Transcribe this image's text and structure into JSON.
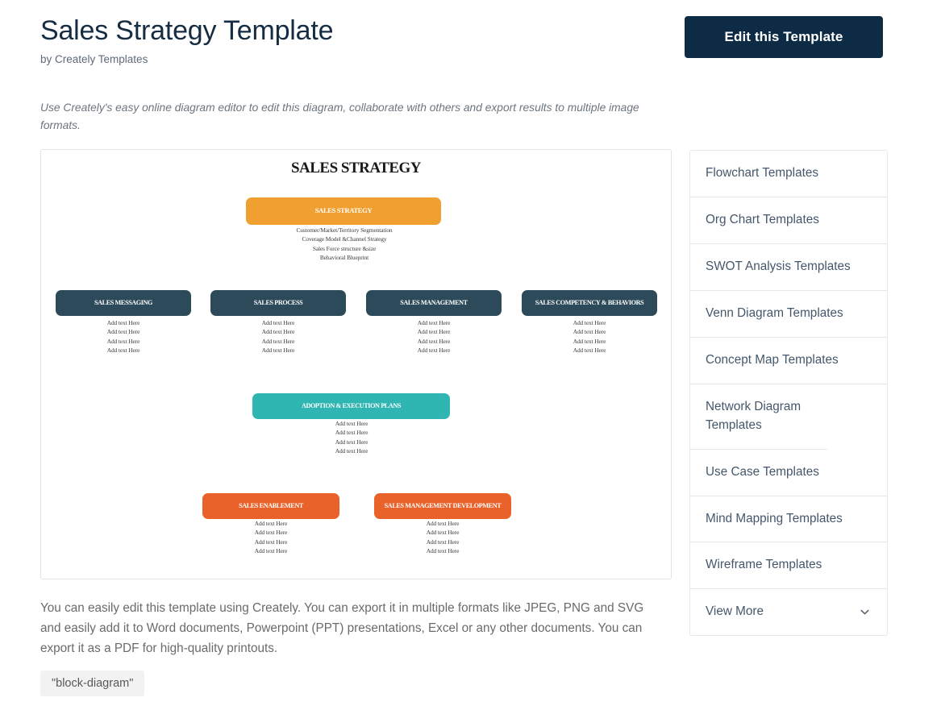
{
  "header": {
    "title": "Sales Strategy Template",
    "byline": "by Creately Templates",
    "edit_button": "Edit this Template"
  },
  "intro": "Use Creately's easy online diagram editor to edit this diagram, collaborate with others and export results to multiple image formats.",
  "diagram": {
    "heading": "SALES STRATEGY",
    "colors": {
      "orange": "#f0a030",
      "dark": "#2c4a5a",
      "teal": "#2fb5b2",
      "redish": "#e8622a"
    },
    "root": {
      "label": "SALES STRATEGY",
      "details": [
        "Customer/Market/Territory   Segmentation",
        "Coverage  Model &Channel  Strategy",
        "Sales  Force structure  &size",
        "Behavioral Blueprint"
      ]
    },
    "level_two": [
      {
        "label": "SALES MESSAGING",
        "details": [
          "Add text Here",
          "Add text Here",
          "Add text Here",
          "Add text Here"
        ]
      },
      {
        "label": "SALES PROCESS",
        "details": [
          "Add text Here",
          "Add text Here",
          "Add text Here",
          "Add text Here"
        ]
      },
      {
        "label": "SALES MANAGEMENT",
        "details": [
          "Add text Here",
          "Add text Here",
          "Add text Here",
          "Add text Here"
        ]
      },
      {
        "label": "SALES COMPETENCY & BEHAVIORS",
        "details": [
          "Add text Here",
          "Add text Here",
          "Add text Here",
          "Add text Here"
        ]
      }
    ],
    "adoption": {
      "label": "ADOPTION & EXECUTION PLANS",
      "details": [
        "Add text Here",
        "Add text Here",
        "Add text Here",
        "Add text Here"
      ]
    },
    "level_four": [
      {
        "label": "SALES ENABLEMENT",
        "details": [
          "Add text Here",
          "Add text Here",
          "Add text Here",
          "Add text Here"
        ]
      },
      {
        "label": "SALES MANAGEMENT DEVELOPMENT",
        "details": [
          "Add text Here",
          "Add text Here",
          "Add text Here",
          "Add text Here"
        ]
      }
    ]
  },
  "sidebar": {
    "items": [
      {
        "label": "Flowchart Templates"
      },
      {
        "label": "Org Chart Templates"
      },
      {
        "label": "SWOT Analysis Templates"
      },
      {
        "label": "Venn Diagram Templates"
      },
      {
        "label": "Concept Map Templates"
      },
      {
        "label": "Network Diagram Templates"
      },
      {
        "label": "Use Case Templates"
      },
      {
        "label": "Mind Mapping Templates"
      },
      {
        "label": "Wireframe Templates"
      }
    ],
    "view_more": "View More"
  },
  "footer": {
    "text": "You can easily edit this template using Creately. You can export it in multiple formats like JPEG, PNG and SVG and easily add it to Word documents, Powerpoint (PPT) presentations, Excel or any other documents. You can export it as a PDF for high-quality printouts.",
    "tag": "\"block-diagram\""
  }
}
